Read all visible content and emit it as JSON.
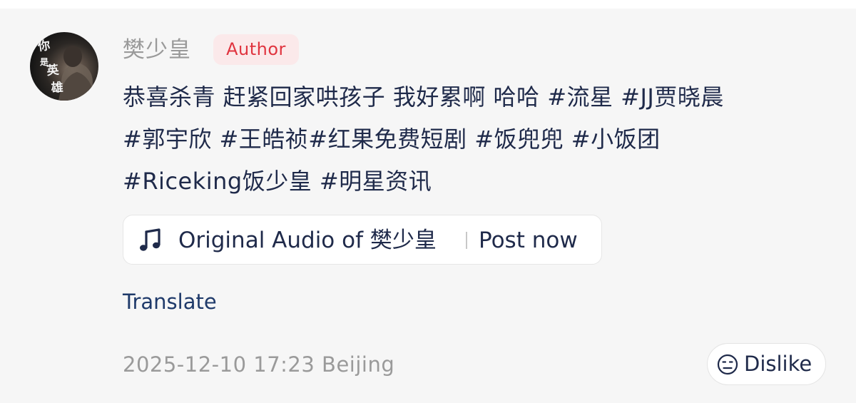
{
  "comment": {
    "author": {
      "name": "樊少皇",
      "badge": "Author",
      "avatar_text": "你 英 雄"
    },
    "content_lines": [
      "恭喜杀青 赶紧回家哄孩子 我好累啊 哈哈 #流星 #JJ贾晓晨",
      "#郭宇欣 #王皓祯#红果免费短剧 #饭兜兜 #小饭团",
      "#Riceking饭少皇 #明星资讯"
    ],
    "audio": {
      "icon": "music-note-icon",
      "label": "Original Audio of 樊少皇",
      "action": "Post now"
    },
    "translate_label": "Translate",
    "timestamp": "2025-12-10 17:23 Beijing",
    "dislike": {
      "icon": "frown-face-icon",
      "label": "Dislike"
    }
  },
  "colors": {
    "background": "#f6f6f6",
    "text_primary": "#1f2a4a",
    "text_secondary": "#9a9a9a",
    "badge_text": "#e0343f",
    "badge_bg": "#fbe9ea",
    "chip_bg": "#ffffff"
  }
}
